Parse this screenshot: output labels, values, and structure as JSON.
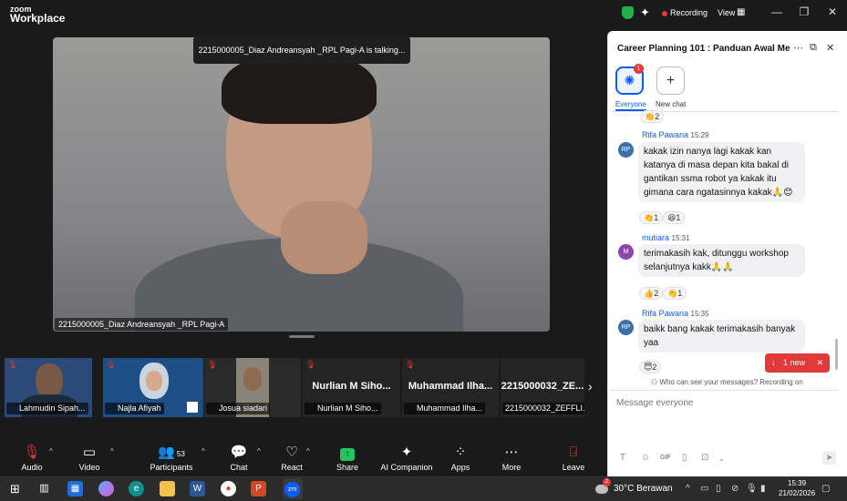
{
  "app": {
    "logo_line1": "zoom",
    "logo_line2": "Workplace",
    "recording_label": "Recording",
    "view_label": "View"
  },
  "meeting": {
    "talking_banner": "2215000005_Diaz Andreansyah _RPL Pagi-A is talking...",
    "main_speaker_label": "2215000005_Diaz Andreansyah _RPL Pagi-A"
  },
  "thumbnails": [
    {
      "label": "Lahmudin Sipah...",
      "name": "",
      "has_video": true
    },
    {
      "label": "Najla Afiyah",
      "name": "",
      "has_video": true
    },
    {
      "label": "Josua siadari",
      "name": "",
      "has_video": true
    },
    {
      "label": "Nurlian M Siho...",
      "name": "Nurlian M Siho...",
      "has_video": false
    },
    {
      "label": "Muhammad Ilha...",
      "name": "Muhammad Ilha...",
      "has_video": false
    },
    {
      "label": "2215000032_ZEFFLI...",
      "name": "2215000032_ZE...",
      "has_video": false
    }
  ],
  "toolbar": {
    "audio": "Audio",
    "video": "Video",
    "participants": "Participants",
    "participants_count": "53",
    "chat": "Chat",
    "react": "React",
    "share": "Share",
    "ai_companion": "AI Companion",
    "apps": "Apps",
    "more": "More",
    "leave": "Leave"
  },
  "chat": {
    "title": "Career Planning 101 : Panduan Awal Mene...",
    "everyone_label": "Everyone",
    "everyone_badge": "1",
    "new_chat_label": "New chat",
    "top_reaction": "👏2",
    "messages": [
      {
        "sender": "Rifa Pawana",
        "time": "15:29",
        "initials": "RP",
        "avatar_color": "#3b6fa8",
        "text": "kakak izin nanya lagi kakak kan katanya di masa depan kita bakal di gantikan ssma robot ya kakak itu gimana cara ngatasinnya kakak🙏😊",
        "reactions": [
          "👏1",
          "😆1"
        ]
      },
      {
        "sender": "mutiara",
        "time": "15:31",
        "initials": "M",
        "avatar_color": "#8e44ad",
        "text": "terimakasih kak, ditunggu workshop selanjutnya kakk🙏🙏",
        "reactions": [
          "👍2",
          "👏1"
        ]
      },
      {
        "sender": "Rifa Pawana",
        "time": "15:35",
        "initials": "RP",
        "avatar_color": "#3b6fa8",
        "text": "baikk bang kakak terimakasih banyak yaa",
        "reactions": [
          "😇2"
        ]
      }
    ],
    "new_pill": "1 new",
    "who_can_see": "Who can see your messages? Recording on",
    "input_placeholder": "Message everyone",
    "gif_label": "GIF"
  },
  "taskbar": {
    "temperature": "30°C",
    "weather": "Berawan",
    "weather_badge": "2",
    "time": "15:39",
    "date": "21/02/2026"
  },
  "colors": {
    "accent": "#0b5cff",
    "record": "#e53935",
    "share": "#22c55e",
    "new_pill": "#e03a3a"
  }
}
